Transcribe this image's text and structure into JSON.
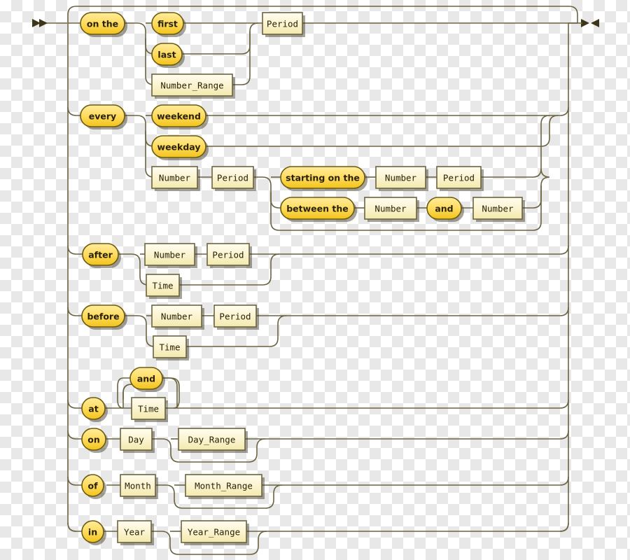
{
  "diagram": {
    "title": "Schedule expression railroad diagram",
    "type": "railroad-syntax-diagram",
    "colors": {
      "terminal_fill_top": "#ffe680",
      "terminal_fill_bottom": "#f5c518",
      "terminal_stroke": "#6b5a12",
      "nonterminal_fill_top": "#fdf8dd",
      "nonterminal_fill_bottom": "#f5edb8",
      "nonterminal_stroke": "#6b6340",
      "rail": "#6b6340",
      "text": "#2a2208"
    },
    "entry_marker": "double-chevron-right",
    "exit_marker": "bowtie",
    "nodes": {
      "on_the": "on the",
      "first": "first",
      "last": "last",
      "number_range": "Number_Range",
      "period_1": "Period",
      "every": "every",
      "weekend": "weekend",
      "weekday": "weekday",
      "number_2": "Number",
      "period_2": "Period",
      "starting_on_the": "starting on the",
      "number_3": "Number",
      "period_3": "Period",
      "between_the": "between the",
      "number_4": "Number",
      "and_1": "and",
      "number_5": "Number",
      "after": "after",
      "number_6": "Number",
      "period_4": "Period",
      "time_1": "Time",
      "before": "before",
      "number_7": "Number",
      "period_5": "Period",
      "time_2": "Time",
      "and_2": "and",
      "at": "at",
      "time_3": "Time",
      "on": "on",
      "day": "Day",
      "day_range": "Day_Range",
      "of": "of",
      "month": "Month",
      "month_range": "Month_Range",
      "in": "in",
      "year": "Year",
      "year_range": "Year_Range"
    },
    "branches": [
      {
        "name": "on-the-branch",
        "terminal": "on the",
        "alternatives": [
          "first",
          "last",
          "Number_Range"
        ],
        "then": [
          "Period"
        ]
      },
      {
        "name": "every-branch",
        "terminal": "every",
        "alternatives": [
          "weekend",
          "weekday",
          "Number Period (starting on the Number Period | between the Number and Number | ø)"
        ]
      },
      {
        "name": "after-branch",
        "terminal": "after",
        "alternatives": [
          "Number Period",
          "Time"
        ]
      },
      {
        "name": "before-branch",
        "terminal": "before",
        "alternatives": [
          "Number Period",
          "Time"
        ]
      },
      {
        "name": "at-branch",
        "terminal": "at",
        "alternatives": [
          "Time (repeat via and)"
        ]
      },
      {
        "name": "on-branch",
        "terminal": "on",
        "alternatives": [
          "Day Day_Range?"
        ]
      },
      {
        "name": "of-branch",
        "terminal": "of",
        "alternatives": [
          "Month Month_Range?"
        ]
      },
      {
        "name": "in-branch",
        "terminal": "in",
        "alternatives": [
          "Year Year_Range?"
        ]
      }
    ]
  }
}
